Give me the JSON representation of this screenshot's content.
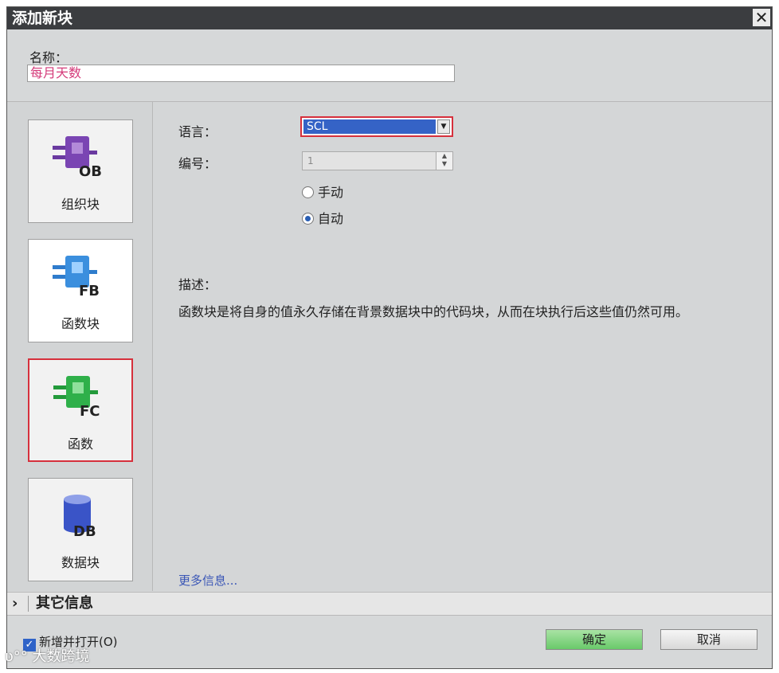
{
  "window": {
    "title": "添加新块",
    "close_symbol": "✕"
  },
  "name_field": {
    "label": "名称：",
    "value": "每月天数"
  },
  "block_types": [
    {
      "label": "组织块",
      "badge": "OB",
      "color": "#7a45b3",
      "selected": false
    },
    {
      "label": "函数块",
      "badge": "FB",
      "color": "#3b8fde",
      "selected": false
    },
    {
      "label": "函数",
      "badge": "FC",
      "color": "#2fb04a",
      "selected": true
    },
    {
      "label": "数据块",
      "badge": "DB",
      "color": "#3a54c7",
      "selected": false
    }
  ],
  "language": {
    "label": "语言：",
    "value": "SCL"
  },
  "number": {
    "label": "编号：",
    "value": "1",
    "options": [
      {
        "label": "手动",
        "checked": false
      },
      {
        "label": "自动",
        "checked": true
      }
    ]
  },
  "description": {
    "label": "描述：",
    "text": "函数块是将自身的值永久存储在背景数据块中的代码块，从而在块执行后这些值仍然可用。"
  },
  "more_link": "更多信息...",
  "more_info_section": {
    "chevron": "›",
    "label": "其它信息"
  },
  "footer": {
    "add_and_open": {
      "label": "新增并打开(O)",
      "checked": true
    },
    "ok_label": "确定",
    "cancel_label": "取消"
  },
  "watermark": "大数跨境",
  "accent_colors": {
    "selection_border": "#d6303c",
    "ok_button": "#6cc96c",
    "dropdown_highlight": "#3563c6"
  }
}
